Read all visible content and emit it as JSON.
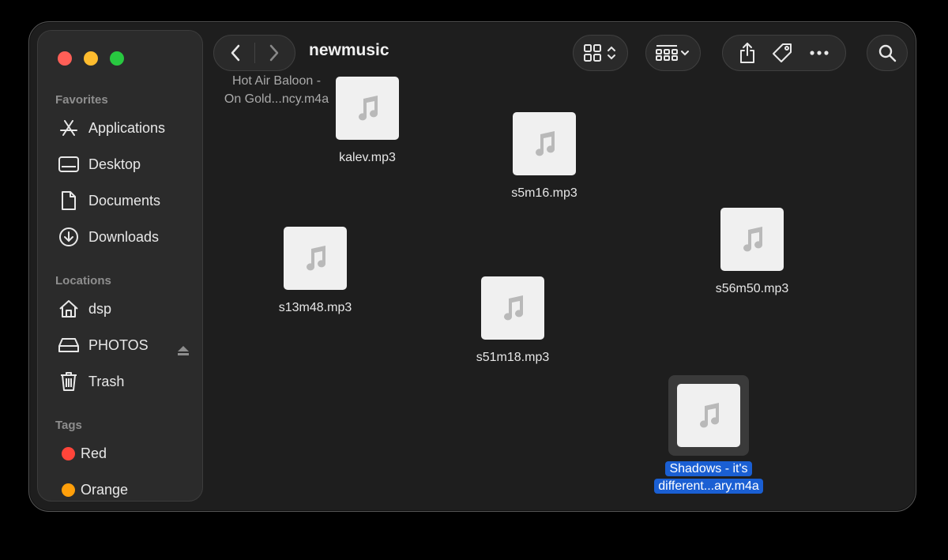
{
  "window": {
    "title": "newmusic"
  },
  "sidebar": {
    "favorites_header": "Favorites",
    "favorites": [
      {
        "label": "Applications",
        "icon": "applications-icon"
      },
      {
        "label": "Desktop",
        "icon": "desktop-icon"
      },
      {
        "label": "Documents",
        "icon": "document-icon"
      },
      {
        "label": "Downloads",
        "icon": "download-icon"
      }
    ],
    "locations_header": "Locations",
    "locations": [
      {
        "label": "dsp",
        "icon": "home-icon"
      },
      {
        "label": "PHOTOS",
        "icon": "drive-icon"
      },
      {
        "label": "Trash",
        "icon": "trash-icon"
      }
    ],
    "tags_header": "Tags",
    "tags": [
      {
        "label": "Red",
        "color": "#ff453a"
      },
      {
        "label": "Orange",
        "color": "#ff9f0a"
      }
    ]
  },
  "files": [
    {
      "name": "kalev.mp3",
      "icon": "music-file-icon"
    },
    {
      "name": "s5m16.mp3",
      "icon": "music-file-icon"
    },
    {
      "name": "s13m48.mp3",
      "icon": "music-file-icon"
    },
    {
      "name": "s56m50.mp3",
      "icon": "music-file-icon"
    },
    {
      "name": "s51m18.mp3",
      "icon": "music-file-icon"
    },
    {
      "name": "Shadows - it's different...ary.m4a",
      "name_line1": "Shadows - it's",
      "name_line2": "different...ary.m4a",
      "icon": "music-file-icon",
      "selected": true
    }
  ],
  "drag_ghost": {
    "line1": "Hot Air Baloon -",
    "line2": "On Gold...ncy.m4a"
  },
  "colors": {
    "selection": "#1a5fd3",
    "window_bg": "#1e1e1e",
    "sidebar_bg": "#2b2b2b"
  }
}
